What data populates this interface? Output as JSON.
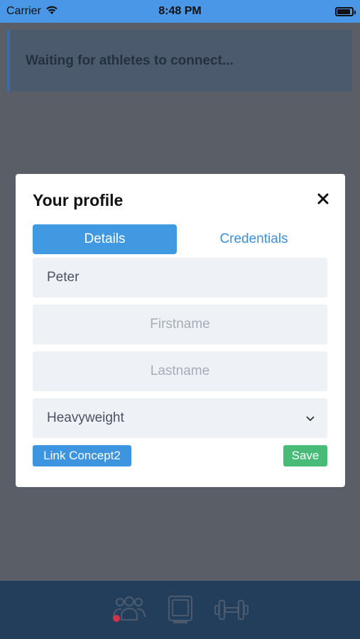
{
  "status_bar": {
    "carrier": "Carrier",
    "time": "8:48 PM",
    "icons": [
      "wifi-icon",
      "battery-icon"
    ]
  },
  "background": {
    "notice_text": "Waiting for athletes to connect..."
  },
  "modal": {
    "title": "Your profile",
    "close_icon": "close-icon",
    "tabs": [
      {
        "label": "Details",
        "active": true
      },
      {
        "label": "Credentials",
        "active": false
      }
    ],
    "fields": {
      "username_value": "Peter",
      "firstname_placeholder": "Firstname",
      "lastname_placeholder": "Lastname",
      "weight_class_value": "Heavyweight"
    },
    "buttons": {
      "link_concept2": "Link Concept2",
      "save": "Save"
    }
  },
  "tab_bar": {
    "icons": [
      "athletes-icon",
      "ergometer-icon",
      "dumbbell-icon"
    ]
  },
  "colors": {
    "status_bar": "#4a97e8",
    "overlay": "#5a5e67",
    "accent": "#4199e1",
    "save": "#48bb78",
    "tab_bar": "#223e5b"
  }
}
